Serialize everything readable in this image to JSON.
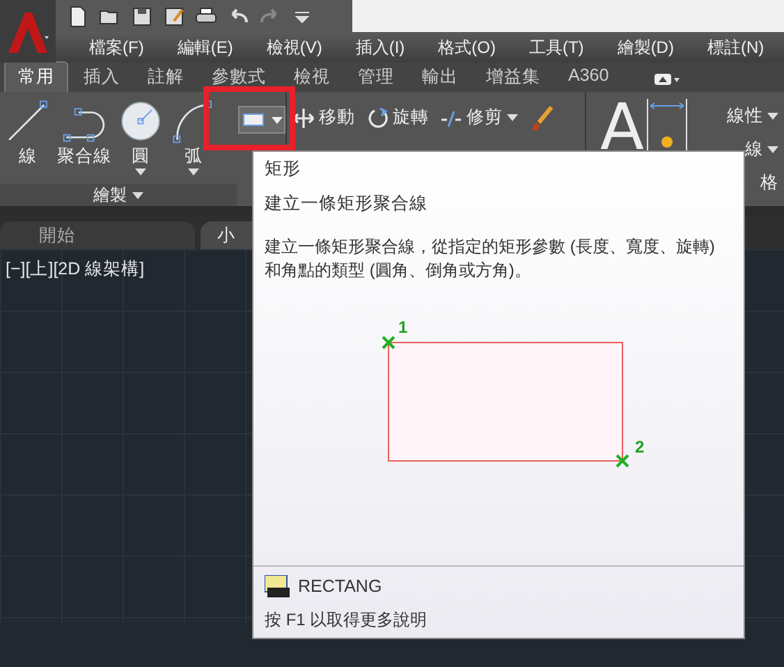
{
  "menu": [
    "檔案(F)",
    "編輯(E)",
    "檢視(V)",
    "插入(I)",
    "格式(O)",
    "工具(T)",
    "繪製(D)",
    "標註(N)"
  ],
  "ribbon_tabs": [
    {
      "label": "常用",
      "selected": true
    },
    {
      "label": "插入",
      "selected": false
    },
    {
      "label": "註解",
      "selected": false
    },
    {
      "label": "參數式",
      "selected": false
    },
    {
      "label": "檢視",
      "selected": false
    },
    {
      "label": "管理",
      "selected": false
    },
    {
      "label": "輸出",
      "selected": false
    },
    {
      "label": "增益集",
      "selected": false
    },
    {
      "label": "A360",
      "selected": false
    }
  ],
  "draw_tools": [
    {
      "label": "線",
      "kind": "line",
      "menu": false
    },
    {
      "label": "聚合線",
      "kind": "polyline",
      "menu": false
    },
    {
      "label": "圓",
      "kind": "circle",
      "menu": true
    },
    {
      "label": "弧",
      "kind": "arc",
      "menu": true
    }
  ],
  "draw_panel_title": "繪製",
  "modify_tools": [
    {
      "label": "移動",
      "kind": "move",
      "menu": false
    },
    {
      "label": "旋轉",
      "kind": "rotate",
      "menu": false
    },
    {
      "label": "修剪",
      "kind": "trim",
      "menu": true
    }
  ],
  "annotation": {
    "text_glyph": "A",
    "tools": [
      {
        "label": "線性",
        "menu": true
      },
      {
        "label": "線",
        "menu": true
      },
      {
        "label": "格",
        "menu": false
      }
    ]
  },
  "file_tabs": [
    {
      "label": "開始",
      "selected": false
    },
    {
      "label": "小",
      "selected": true
    }
  ],
  "viewport_label": "[−][上][2D 線架構]",
  "tooltip": {
    "title": "矩形",
    "subtitle": "建立一條矩形聚合線",
    "description": "建立一條矩形聚合線，從指定的矩形參數 (長度、寬度、旋轉) 和角點的類型 (圓角、倒角或方角)。",
    "points": [
      "1",
      "2"
    ],
    "command": "RECTANG",
    "help": "按 F1 以取得更多說明"
  }
}
